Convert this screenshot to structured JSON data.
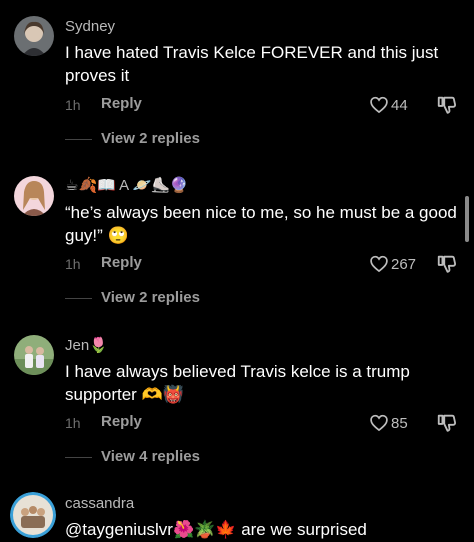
{
  "comments": [
    {
      "username": "Sydney",
      "text": "I have hated Travis Kelce FOREVER and this just proves it",
      "time": "1h",
      "reply_label": "Reply",
      "likes": "44",
      "view_replies": "View 2 replies"
    },
    {
      "username": "☕🍂📖 A 🪐⛸️🔮",
      "text": "“he’s always been nice to me, so he must be a good guy!” 🙄",
      "time": "1h",
      "reply_label": "Reply",
      "likes": "267",
      "view_replies": "View 2 replies"
    },
    {
      "username": "Jen🌷",
      "text": "I have always believed Travis kelce is a trump supporter 🫶👹",
      "time": "1h",
      "reply_label": "Reply",
      "likes": "85",
      "view_replies": "View 4 replies"
    },
    {
      "username": "cassandra",
      "text": "@taygeniuslvr🌺🪴🍁 are we surprised"
    }
  ],
  "colors": {
    "background": "#000000",
    "username": "#b9b9b9",
    "meta": "#9c9c9c",
    "mention": "#a8c3ff"
  },
  "icons": {
    "like": "heart-outline-icon",
    "dislike": "thumbs-down-icon"
  }
}
